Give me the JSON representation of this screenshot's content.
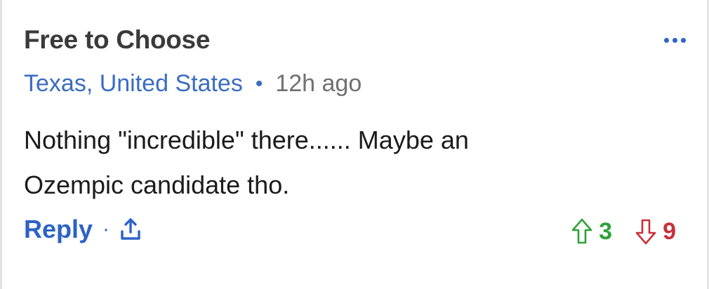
{
  "comment": {
    "author": "Free to Choose",
    "location": "Texas, United States",
    "separator": "•",
    "time": "12h ago",
    "body_line1": "Nothing \"incredible\" there...... Maybe an",
    "body_line2": "Ozempic candidate tho.",
    "reply_label": "Reply",
    "footer_separator": "·",
    "upvotes": "3",
    "downvotes": "9"
  },
  "icons": {
    "more": "more-options-icon",
    "share": "share-icon",
    "upvote": "arrow-up-icon",
    "downvote": "arrow-down-icon"
  },
  "colors": {
    "link": "#2c62c7",
    "upvote": "#2fa23a",
    "downvote": "#c8313a"
  }
}
